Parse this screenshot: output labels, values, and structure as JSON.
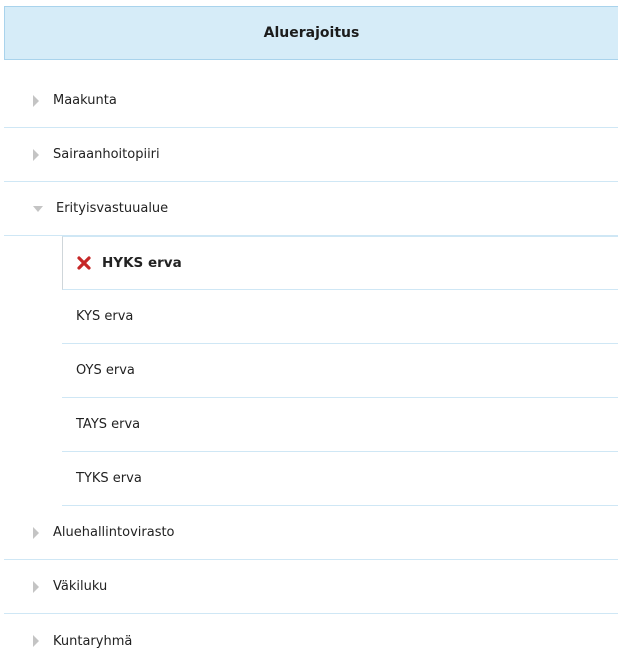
{
  "header": {
    "title": "Aluerajoitus"
  },
  "colors": {
    "header_bg": "#d6ecf8",
    "row_border": "#cfe7f5",
    "remove_icon": "#c62828",
    "arrow": "#c4c4c4"
  },
  "groups": [
    {
      "label": "Maakunta",
      "expanded": false,
      "icon": "triangle-right-icon"
    },
    {
      "label": "Sairaanhoitopiiri",
      "expanded": false,
      "icon": "triangle-right-icon"
    },
    {
      "label": "Erityisvastuualue",
      "expanded": true,
      "icon": "triangle-down-icon",
      "children": [
        {
          "label": "HYKS erva",
          "selected": true,
          "icon": "remove-icon"
        },
        {
          "label": "KYS erva",
          "selected": false
        },
        {
          "label": "OYS erva",
          "selected": false
        },
        {
          "label": "TAYS erva",
          "selected": false
        },
        {
          "label": "TYKS erva",
          "selected": false
        }
      ]
    },
    {
      "label": "Aluehallintovirasto",
      "expanded": false,
      "icon": "triangle-right-icon"
    },
    {
      "label": "Väkiluku",
      "expanded": false,
      "icon": "triangle-right-icon"
    },
    {
      "label": "Kuntaryhmä",
      "expanded": false,
      "icon": "triangle-right-icon"
    }
  ]
}
